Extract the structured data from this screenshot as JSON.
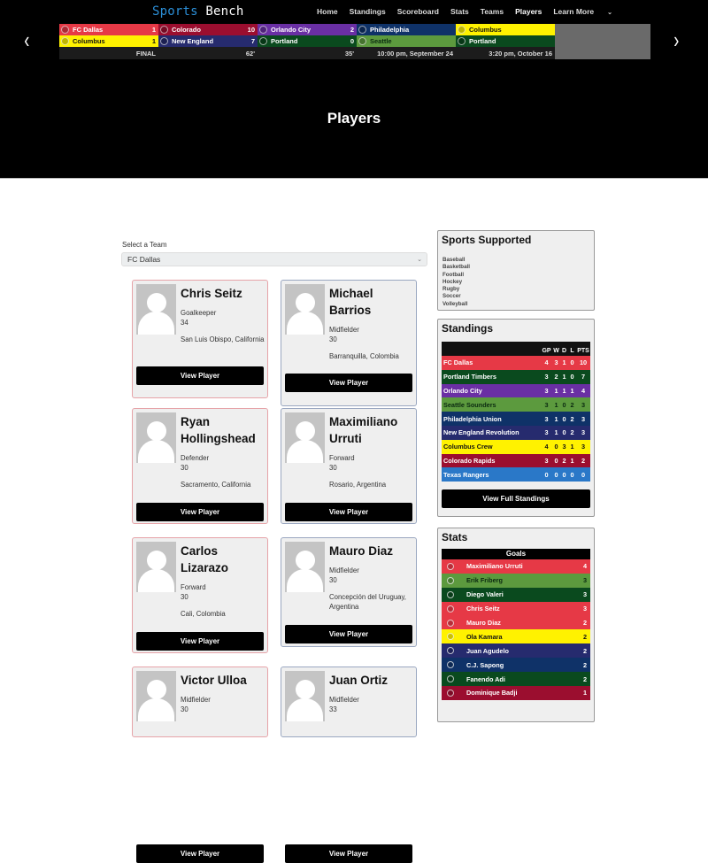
{
  "site": {
    "logo_part1": "Sports",
    "logo_part2": " Bench",
    "nav": [
      {
        "label": "Home",
        "active": false
      },
      {
        "label": "Standings",
        "active": false
      },
      {
        "label": "Scoreboard",
        "active": false
      },
      {
        "label": "Stats",
        "active": false
      },
      {
        "label": "Teams",
        "active": false
      },
      {
        "label": "Players",
        "active": true
      },
      {
        "label": "Learn More",
        "active": false
      }
    ],
    "learn_more_chevron": "⌄",
    "prev_arrow": "‹",
    "next_arrow": "›"
  },
  "ticker": [
    {
      "home": {
        "name": "FC Dallas",
        "score": "1",
        "color": "#e63946",
        "text": "#ffffff"
      },
      "away": {
        "name": "Columbus",
        "score": "1",
        "color": "#fff200",
        "text": "#111111"
      },
      "status": "FINAL"
    },
    {
      "home": {
        "name": "Colorado",
        "score": "10",
        "color": "#9b0e2f",
        "text": "#ffffff"
      },
      "away": {
        "name": "New England",
        "score": "7",
        "color": "#262b6e",
        "text": "#ffffff"
      },
      "status": "62'"
    },
    {
      "home": {
        "name": "Orlando City",
        "score": "2",
        "color": "#6a2fa4",
        "text": "#ffffff"
      },
      "away": {
        "name": "Portland",
        "score": "0",
        "color": "#0a4a1e",
        "text": "#ffffff"
      },
      "status": "35'"
    },
    {
      "home": {
        "name": "Philadelphia",
        "score": "",
        "color": "#0f3268",
        "text": "#ffffff"
      },
      "away": {
        "name": "Seattle",
        "score": "",
        "color": "#5c9a3e",
        "text": "#0a2a10"
      },
      "status": "10:00 pm, September 24"
    },
    {
      "home": {
        "name": "Columbus",
        "score": "",
        "color": "#fff200",
        "text": "#111111"
      },
      "away": {
        "name": "Portland",
        "score": "",
        "color": "#0a4a1e",
        "text": "#ffffff"
      },
      "status": "3:20 pm, October 16"
    }
  ],
  "page_title": "Players",
  "team_select": {
    "label": "Select a Team",
    "value": "FC Dallas"
  },
  "players": [
    {
      "name": "Chris Seitz",
      "position": "Goalkeeper",
      "number": "34",
      "hometown": "San Luis Obispo, California",
      "button": "View Player"
    },
    {
      "name": "Michael Barrios",
      "position": "Midfielder",
      "number": "30",
      "hometown": "Barranquilla, Colombia",
      "button": "View Player"
    },
    {
      "name": "Ryan Hollingshead",
      "position": "Defender",
      "number": "30",
      "hometown": "Sacramento, California",
      "button": "View Player"
    },
    {
      "name": "Maximiliano Urruti",
      "position": "Forward",
      "number": "30",
      "hometown": "Rosario, Argentina",
      "button": "View Player"
    },
    {
      "name": "Carlos Lizarazo",
      "position": "Forward",
      "number": "30",
      "hometown": "Cali, Colombia",
      "button": "View Player"
    },
    {
      "name": "Mauro Diaz",
      "position": "Midfielder",
      "number": "30",
      "hometown": "Concepción del Uruguay, Argentina",
      "button": "View Player"
    },
    {
      "name": "Victor Ulloa",
      "position": "Midfielder",
      "number": "30",
      "hometown": "",
      "button": "View Player"
    },
    {
      "name": "Juan Ortiz",
      "position": "Midfielder",
      "number": "33",
      "hometown": "",
      "button": "View Player"
    }
  ],
  "sports_supported": {
    "title": "Sports Supported",
    "items": [
      "Baseball",
      "Basketball",
      "Football",
      "Hockey",
      "Rugby",
      "Soccer",
      "Volleyball"
    ]
  },
  "standings": {
    "title": "Standings",
    "columns": [
      "GP",
      "W",
      "D",
      "L",
      "PTS"
    ],
    "rows": [
      {
        "team": "FC Dallas",
        "gp": "4",
        "w": "3",
        "d": "1",
        "l": "0",
        "pts": "10",
        "color": "#e63946",
        "text": "#ffffff"
      },
      {
        "team": "Portland Timbers",
        "gp": "3",
        "w": "2",
        "d": "1",
        "l": "0",
        "pts": "7",
        "color": "#0a4a1e",
        "text": "#ffffff"
      },
      {
        "team": "Orlando City",
        "gp": "3",
        "w": "1",
        "d": "1",
        "l": "1",
        "pts": "4",
        "color": "#6a2fa4",
        "text": "#ffffff"
      },
      {
        "team": "Seattle Sounders",
        "gp": "3",
        "w": "1",
        "d": "0",
        "l": "2",
        "pts": "3",
        "color": "#5c9a3e",
        "text": "#0a2a10"
      },
      {
        "team": "Philadelphia Union",
        "gp": "3",
        "w": "1",
        "d": "0",
        "l": "2",
        "pts": "3",
        "color": "#0f3268",
        "text": "#ffffff"
      },
      {
        "team": "New England Revolution",
        "gp": "3",
        "w": "1",
        "d": "0",
        "l": "2",
        "pts": "3",
        "color": "#262b6e",
        "text": "#ffffff"
      },
      {
        "team": "Columbus Crew",
        "gp": "4",
        "w": "0",
        "d": "3",
        "l": "1",
        "pts": "3",
        "color": "#fff200",
        "text": "#111111"
      },
      {
        "team": "Colorado Rapids",
        "gp": "3",
        "w": "0",
        "d": "2",
        "l": "1",
        "pts": "2",
        "color": "#9b0e2f",
        "text": "#ffffff"
      },
      {
        "team": "Texas Rangers",
        "gp": "0",
        "w": "0",
        "d": "0",
        "l": "0",
        "pts": "0",
        "color": "#2a78c8",
        "text": "#ffffff"
      }
    ],
    "button": "View Full Standings"
  },
  "stats": {
    "title": "Stats",
    "category": "Goals",
    "rows": [
      {
        "player": "Maximiliano Urruti",
        "value": "4",
        "color": "#e63946",
        "text": "#ffffff"
      },
      {
        "player": "Erik Friberg",
        "value": "3",
        "color": "#5c9a3e",
        "text": "#0a2a10"
      },
      {
        "player": "Diego Valeri",
        "value": "3",
        "color": "#0a4a1e",
        "text": "#ffffff"
      },
      {
        "player": "Chris Seitz",
        "value": "3",
        "color": "#e63946",
        "text": "#ffffff"
      },
      {
        "player": "Mauro Diaz",
        "value": "2",
        "color": "#e63946",
        "text": "#ffffff"
      },
      {
        "player": "Ola Kamara",
        "value": "2",
        "color": "#fff200",
        "text": "#111111"
      },
      {
        "player": "Juan Agudelo",
        "value": "2",
        "color": "#262b6e",
        "text": "#ffffff"
      },
      {
        "player": "C.J. Sapong",
        "value": "2",
        "color": "#0f3268",
        "text": "#ffffff"
      },
      {
        "player": "Fanendo Adi",
        "value": "2",
        "color": "#0a4a1e",
        "text": "#ffffff"
      },
      {
        "player": "Dominique Badji",
        "value": "1",
        "color": "#9b0e2f",
        "text": "#ffffff"
      }
    ]
  }
}
